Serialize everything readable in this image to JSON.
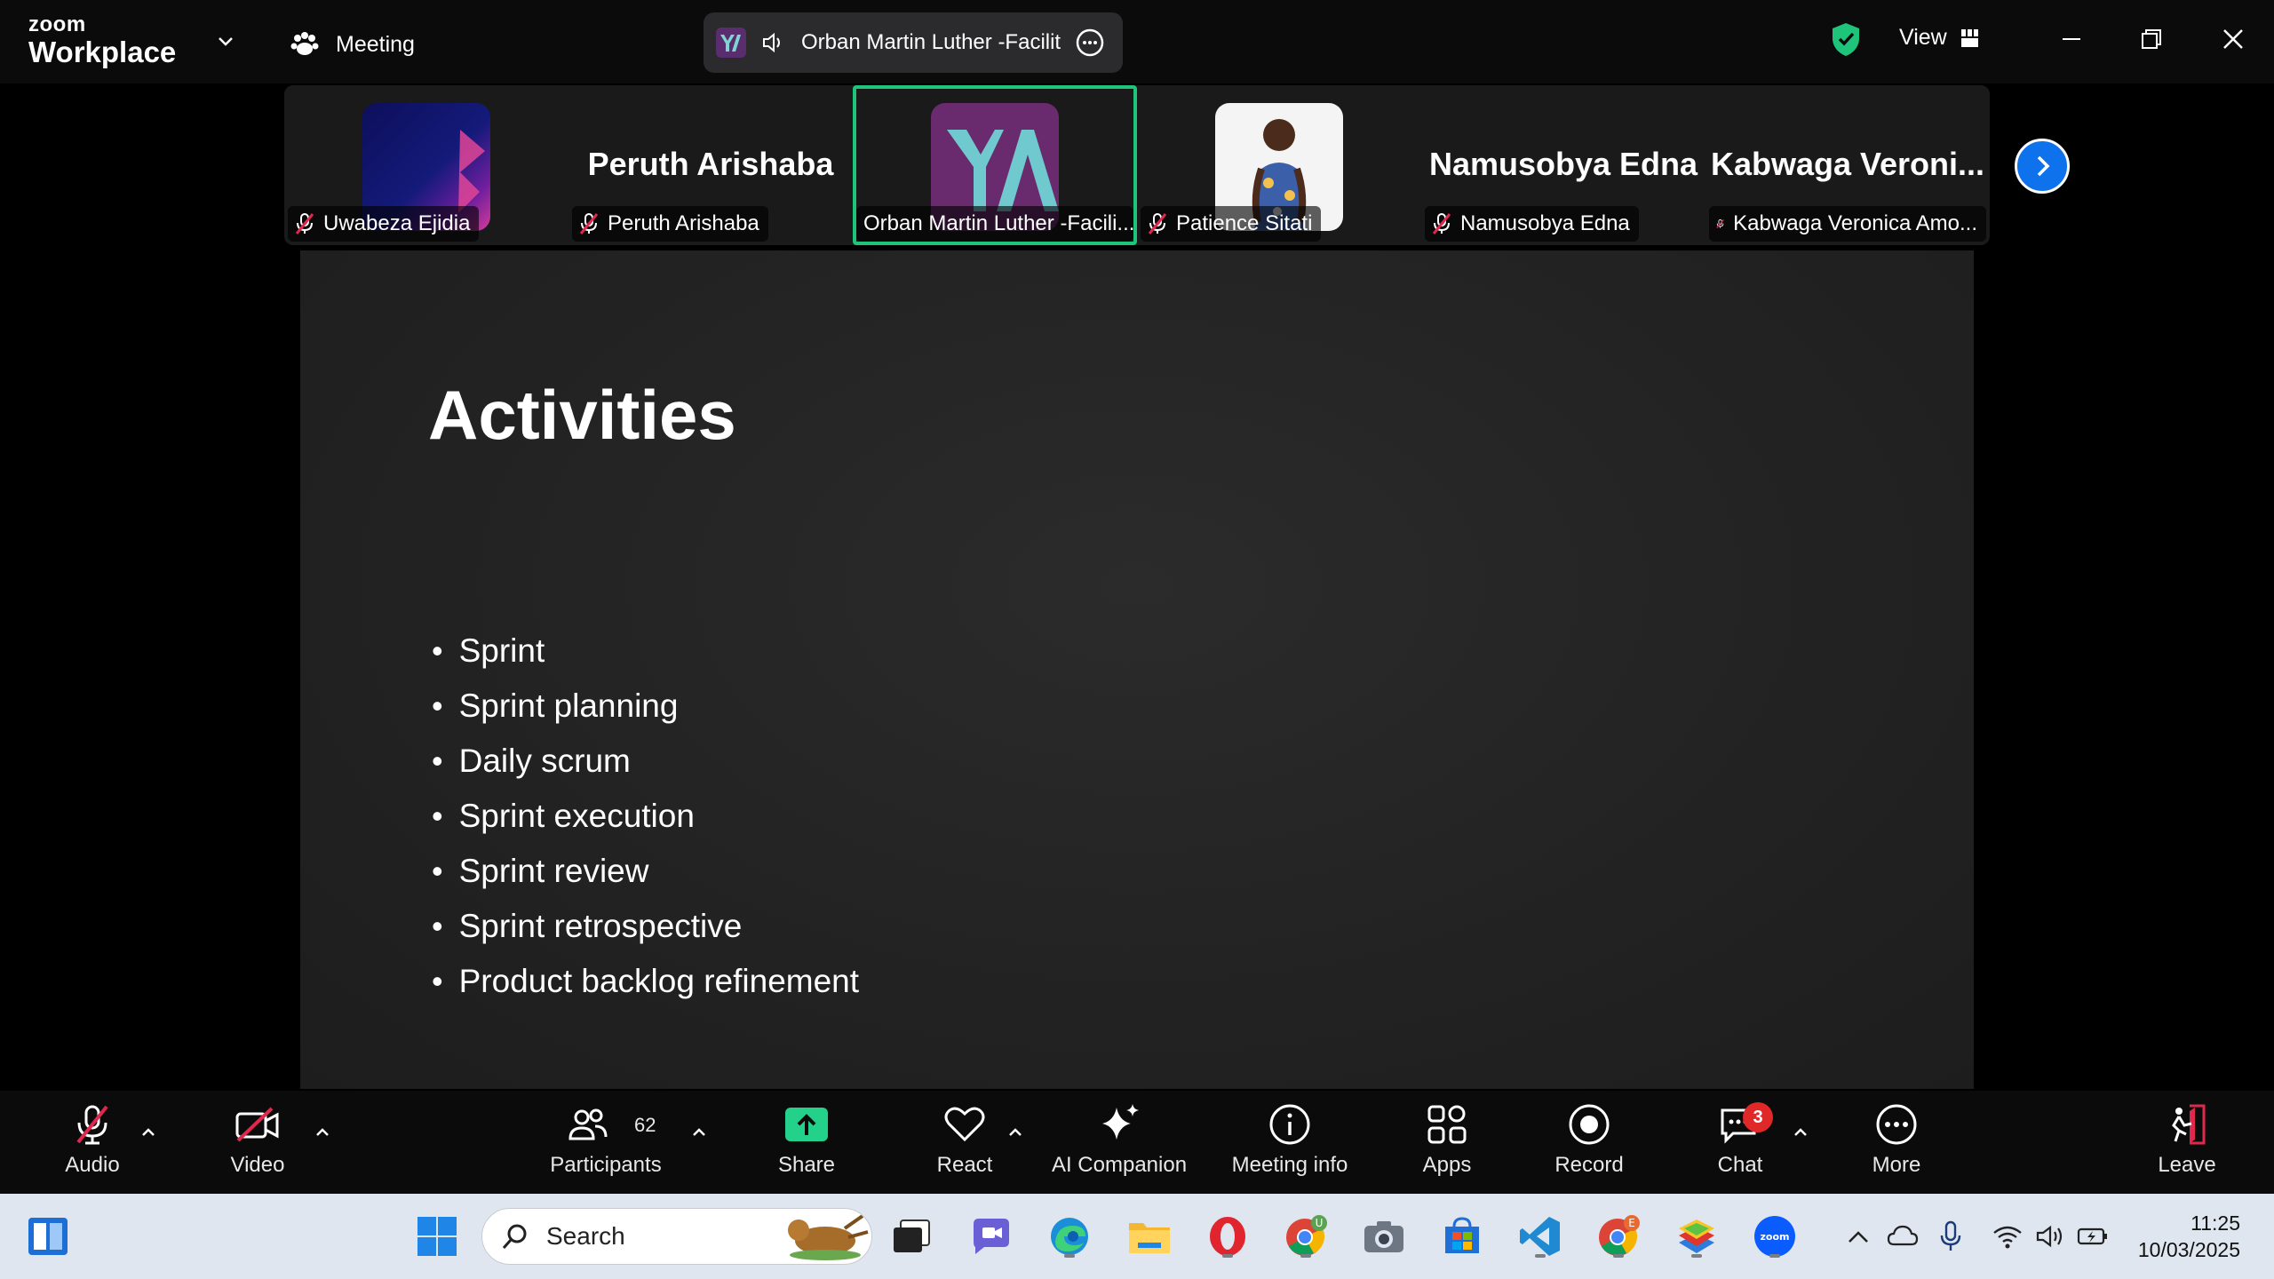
{
  "titlebar": {
    "logo_top": "zoom",
    "logo_bottom": "Workplace",
    "meeting_label": "Meeting",
    "speaker_name": "Orban Martin Luther -Facilit",
    "view_label": "View"
  },
  "gallery": {
    "tiles": [
      {
        "label": "Uwabeza Ejidia",
        "big_name": ""
      },
      {
        "label": "Peruth Arishaba",
        "big_name": "Peruth Arishaba"
      },
      {
        "label": "Orban Martin Luther -Facili...",
        "big_name": ""
      },
      {
        "label": "Patience Sitati",
        "big_name": ""
      },
      {
        "label": "Namusobya Edna",
        "big_name": "Namusobya Edna"
      },
      {
        "label": "Kabwaga Veronica Amo...",
        "big_name": "Kabwaga  Veroni..."
      }
    ]
  },
  "slide": {
    "title": "Activities",
    "bullets": [
      "Sprint",
      "Sprint planning",
      "Daily scrum",
      "Sprint execution",
      "Sprint review",
      "Sprint retrospective",
      "Product backlog refinement"
    ]
  },
  "controls": {
    "audio": "Audio",
    "video": "Video",
    "participants": "Participants",
    "participants_count": "62",
    "share": "Share",
    "react": "React",
    "ai_companion": "AI Companion",
    "meeting_info": "Meeting info",
    "apps": "Apps",
    "record": "Record",
    "chat": "Chat",
    "chat_badge": "3",
    "more": "More",
    "leave": "Leave"
  },
  "taskbar": {
    "search_placeholder": "Search",
    "time": "11:25",
    "date": "10/03/2025"
  },
  "colors": {
    "active_speaker_border": "#1ec47a",
    "share_green": "#23d18b",
    "zoom_blue": "#0e72ed",
    "mute_red": "#e0284f",
    "badge_red": "#e02828"
  }
}
